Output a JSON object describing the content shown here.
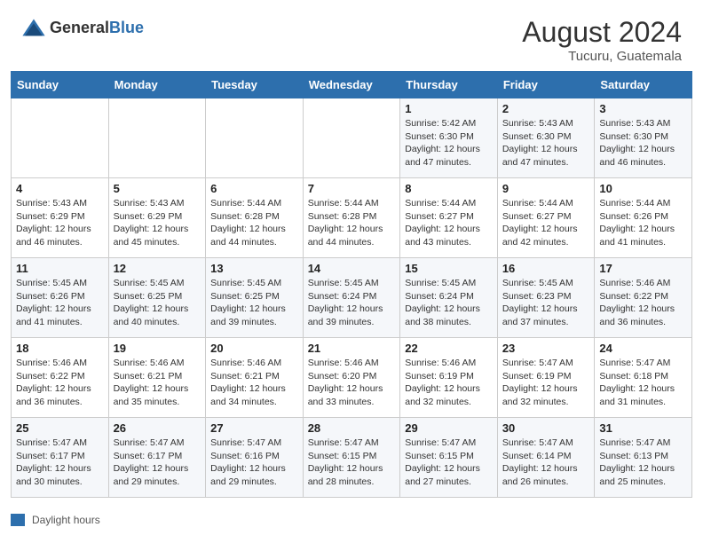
{
  "header": {
    "logo_general": "General",
    "logo_blue": "Blue",
    "title": "August 2024",
    "subtitle": "Tucuru, Guatemala"
  },
  "calendar": {
    "days_of_week": [
      "Sunday",
      "Monday",
      "Tuesday",
      "Wednesday",
      "Thursday",
      "Friday",
      "Saturday"
    ],
    "weeks": [
      [
        {
          "day": "",
          "info": ""
        },
        {
          "day": "",
          "info": ""
        },
        {
          "day": "",
          "info": ""
        },
        {
          "day": "",
          "info": ""
        },
        {
          "day": "1",
          "info": "Sunrise: 5:42 AM\nSunset: 6:30 PM\nDaylight: 12 hours\nand 47 minutes."
        },
        {
          "day": "2",
          "info": "Sunrise: 5:43 AM\nSunset: 6:30 PM\nDaylight: 12 hours\nand 47 minutes."
        },
        {
          "day": "3",
          "info": "Sunrise: 5:43 AM\nSunset: 6:30 PM\nDaylight: 12 hours\nand 46 minutes."
        }
      ],
      [
        {
          "day": "4",
          "info": "Sunrise: 5:43 AM\nSunset: 6:29 PM\nDaylight: 12 hours\nand 46 minutes."
        },
        {
          "day": "5",
          "info": "Sunrise: 5:43 AM\nSunset: 6:29 PM\nDaylight: 12 hours\nand 45 minutes."
        },
        {
          "day": "6",
          "info": "Sunrise: 5:44 AM\nSunset: 6:28 PM\nDaylight: 12 hours\nand 44 minutes."
        },
        {
          "day": "7",
          "info": "Sunrise: 5:44 AM\nSunset: 6:28 PM\nDaylight: 12 hours\nand 44 minutes."
        },
        {
          "day": "8",
          "info": "Sunrise: 5:44 AM\nSunset: 6:27 PM\nDaylight: 12 hours\nand 43 minutes."
        },
        {
          "day": "9",
          "info": "Sunrise: 5:44 AM\nSunset: 6:27 PM\nDaylight: 12 hours\nand 42 minutes."
        },
        {
          "day": "10",
          "info": "Sunrise: 5:44 AM\nSunset: 6:26 PM\nDaylight: 12 hours\nand 41 minutes."
        }
      ],
      [
        {
          "day": "11",
          "info": "Sunrise: 5:45 AM\nSunset: 6:26 PM\nDaylight: 12 hours\nand 41 minutes."
        },
        {
          "day": "12",
          "info": "Sunrise: 5:45 AM\nSunset: 6:25 PM\nDaylight: 12 hours\nand 40 minutes."
        },
        {
          "day": "13",
          "info": "Sunrise: 5:45 AM\nSunset: 6:25 PM\nDaylight: 12 hours\nand 39 minutes."
        },
        {
          "day": "14",
          "info": "Sunrise: 5:45 AM\nSunset: 6:24 PM\nDaylight: 12 hours\nand 39 minutes."
        },
        {
          "day": "15",
          "info": "Sunrise: 5:45 AM\nSunset: 6:24 PM\nDaylight: 12 hours\nand 38 minutes."
        },
        {
          "day": "16",
          "info": "Sunrise: 5:45 AM\nSunset: 6:23 PM\nDaylight: 12 hours\nand 37 minutes."
        },
        {
          "day": "17",
          "info": "Sunrise: 5:46 AM\nSunset: 6:22 PM\nDaylight: 12 hours\nand 36 minutes."
        }
      ],
      [
        {
          "day": "18",
          "info": "Sunrise: 5:46 AM\nSunset: 6:22 PM\nDaylight: 12 hours\nand 36 minutes."
        },
        {
          "day": "19",
          "info": "Sunrise: 5:46 AM\nSunset: 6:21 PM\nDaylight: 12 hours\nand 35 minutes."
        },
        {
          "day": "20",
          "info": "Sunrise: 5:46 AM\nSunset: 6:21 PM\nDaylight: 12 hours\nand 34 minutes."
        },
        {
          "day": "21",
          "info": "Sunrise: 5:46 AM\nSunset: 6:20 PM\nDaylight: 12 hours\nand 33 minutes."
        },
        {
          "day": "22",
          "info": "Sunrise: 5:46 AM\nSunset: 6:19 PM\nDaylight: 12 hours\nand 32 minutes."
        },
        {
          "day": "23",
          "info": "Sunrise: 5:47 AM\nSunset: 6:19 PM\nDaylight: 12 hours\nand 32 minutes."
        },
        {
          "day": "24",
          "info": "Sunrise: 5:47 AM\nSunset: 6:18 PM\nDaylight: 12 hours\nand 31 minutes."
        }
      ],
      [
        {
          "day": "25",
          "info": "Sunrise: 5:47 AM\nSunset: 6:17 PM\nDaylight: 12 hours\nand 30 minutes."
        },
        {
          "day": "26",
          "info": "Sunrise: 5:47 AM\nSunset: 6:17 PM\nDaylight: 12 hours\nand 29 minutes."
        },
        {
          "day": "27",
          "info": "Sunrise: 5:47 AM\nSunset: 6:16 PM\nDaylight: 12 hours\nand 29 minutes."
        },
        {
          "day": "28",
          "info": "Sunrise: 5:47 AM\nSunset: 6:15 PM\nDaylight: 12 hours\nand 28 minutes."
        },
        {
          "day": "29",
          "info": "Sunrise: 5:47 AM\nSunset: 6:15 PM\nDaylight: 12 hours\nand 27 minutes."
        },
        {
          "day": "30",
          "info": "Sunrise: 5:47 AM\nSunset: 6:14 PM\nDaylight: 12 hours\nand 26 minutes."
        },
        {
          "day": "31",
          "info": "Sunrise: 5:47 AM\nSunset: 6:13 PM\nDaylight: 12 hours\nand 25 minutes."
        }
      ]
    ]
  },
  "legend": {
    "label": "Daylight hours"
  }
}
